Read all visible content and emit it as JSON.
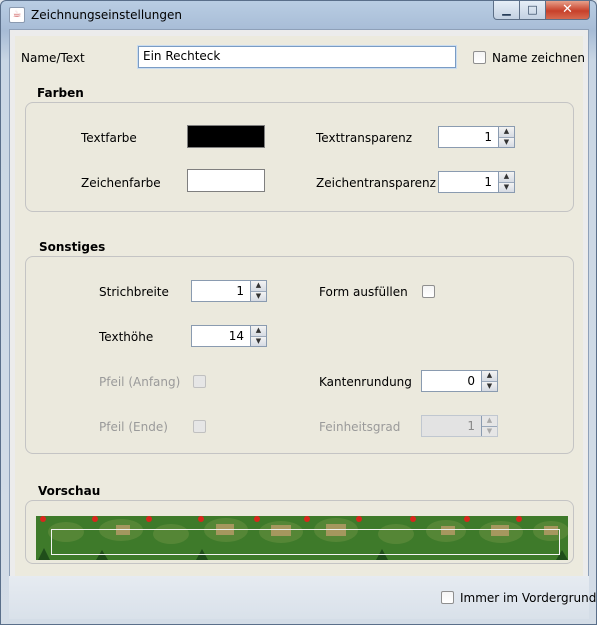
{
  "window": {
    "title": "Zeichnungseinstellungen",
    "icon": "java-coffee-icon",
    "buttons": {
      "minimize": "minimize-icon",
      "maximize": "maximize-icon",
      "close": "close-icon"
    }
  },
  "name_row": {
    "label": "Name/Text",
    "value": "Ein Rechteck",
    "draw_name_label": "Name zeichnen",
    "draw_name_checked": false
  },
  "farben": {
    "title": "Farben",
    "textfarbe_label": "Textfarbe",
    "textfarbe_color": "#000000",
    "zeichenfarbe_label": "Zeichenfarbe",
    "zeichenfarbe_color": "#ffffff",
    "texttransparenz_label": "Texttransparenz",
    "texttransparenz_value": "1",
    "zeichentransparenz_label": "Zeichentransparenz",
    "zeichentransparenz_value": "1"
  },
  "sonstiges": {
    "title": "Sonstiges",
    "strichbreite_label": "Strichbreite",
    "strichbreite_value": "1",
    "texthoehe_label": "Texthöhe",
    "texthoehe_value": "14",
    "form_ausfuellen_label": "Form ausfüllen",
    "form_ausfuellen_checked": false,
    "pfeil_anfang_label": "Pfeil (Anfang)",
    "pfeil_ende_label": "Pfeil (Ende)",
    "kantenrundung_label": "Kantenrundung",
    "kantenrundung_value": "0",
    "feinheitsgrad_label": "Feinheitsgrad",
    "feinheitsgrad_value": "1"
  },
  "vorschau": {
    "title": "Vorschau",
    "background_color": "#3e7a2a",
    "marker_color": "#d9261c",
    "rectangle_color": "#f3f3f3"
  },
  "footer": {
    "always_on_top_label": "Immer im Vordergrund",
    "always_on_top_checked": false
  }
}
